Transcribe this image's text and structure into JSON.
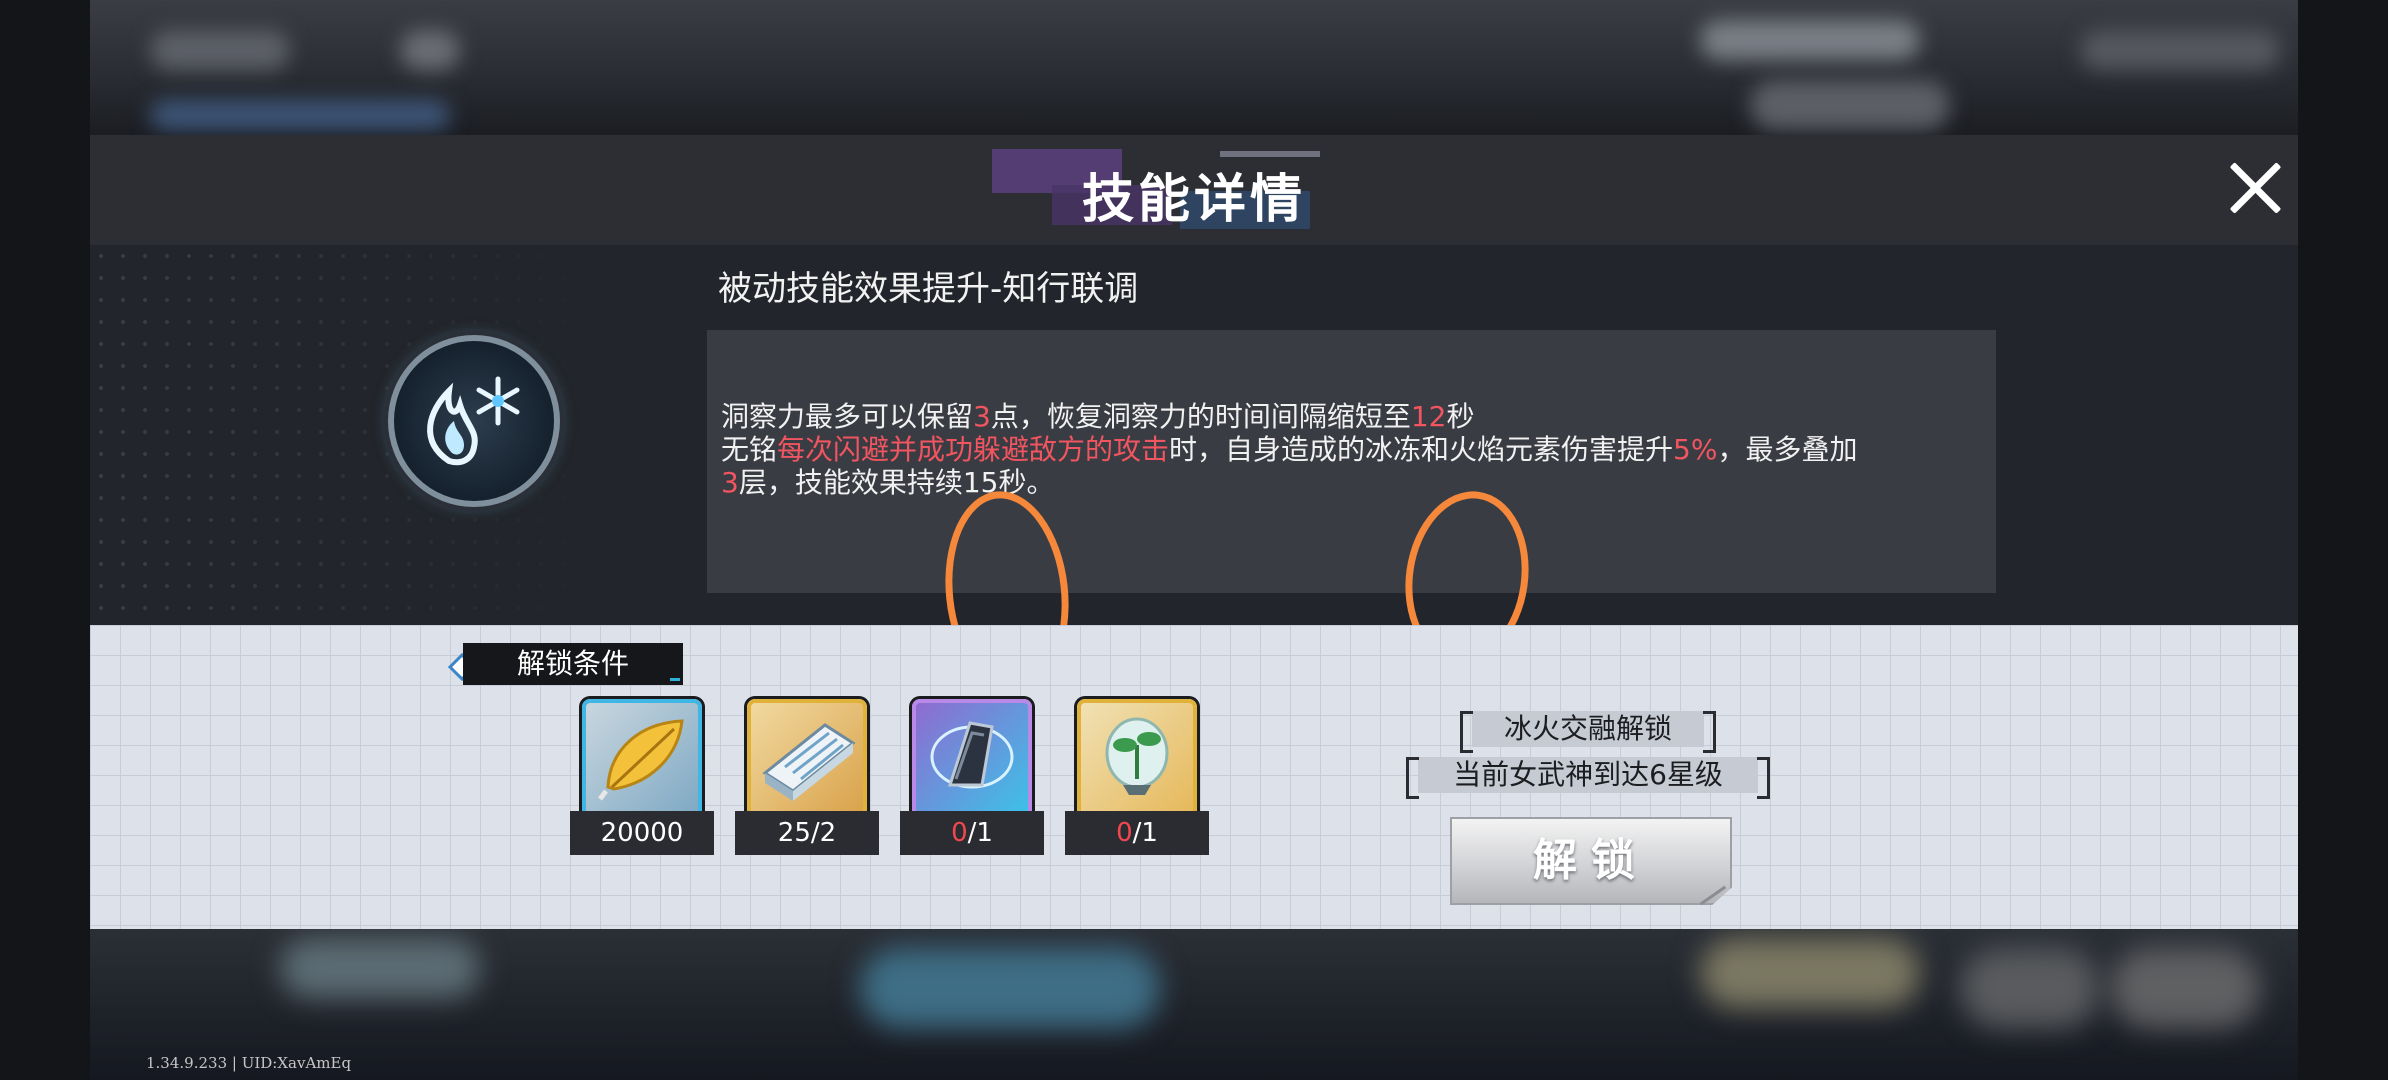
{
  "header": {
    "title": "技能详情"
  },
  "skill": {
    "name": "被动技能效果提升-知行联调",
    "icon": "fire-ice-emblem-icon",
    "description_line1": {
      "p1": "洞察力最多可以保留",
      "v1": "3",
      "p2": "点，恢复洞察力的时间间隔缩短至",
      "v2": "12",
      "p3": "秒"
    },
    "description_line2": {
      "p1": "无铭",
      "h1": "每次闪避并成功躲避敌方的攻击",
      "p2": "时，自身造成的冰冻和火焰元素伤害提升",
      "h2": "5%",
      "p3": "，最多叠加",
      "v3": "3",
      "p4": "层，技能效果持续15秒。"
    }
  },
  "unlock": {
    "section_label": "解锁条件",
    "items": [
      {
        "icon": "gold-feather-icon",
        "count": "20000",
        "count_red": "",
        "count_rest": "",
        "frame_color": "#3fb6e3"
      },
      {
        "icon": "manual-book-icon",
        "count": "25/2",
        "count_red": "",
        "count_rest": "",
        "frame_color": "#e0b23a"
      },
      {
        "icon": "crystal-shard-icon",
        "count": "",
        "count_red": "0",
        "count_rest": "/1",
        "frame_color": "#b889e6"
      },
      {
        "icon": "sprout-vial-icon",
        "count": "",
        "count_red": "0",
        "count_rest": "/1",
        "frame_color": "#e0b23a"
      }
    ],
    "requirements": [
      "冰火交融解锁",
      "当前女武神到达6星级"
    ],
    "button_label": "解锁"
  },
  "footer": {
    "version": "1.34.9.233 | UID:XavAmEq"
  },
  "colors": {
    "highlight": "#f05560",
    "annotation": "#f5883a",
    "panel_dark": "#22252b",
    "panel_light": "#dde1ea"
  }
}
